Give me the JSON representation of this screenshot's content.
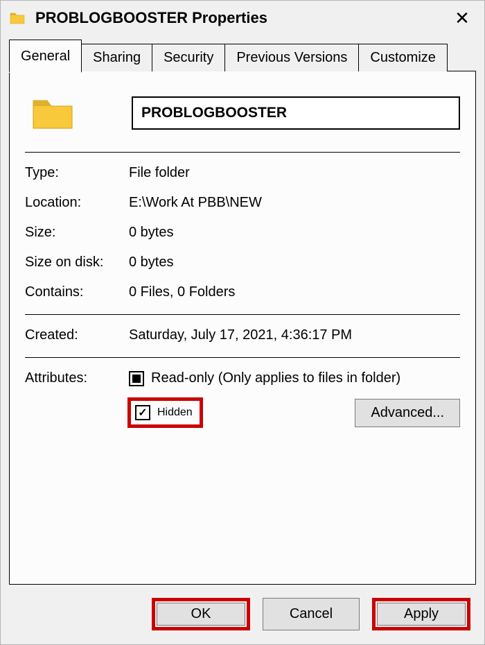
{
  "titlebar": {
    "title": "PROBLOGBOOSTER Properties"
  },
  "tabs": {
    "items": [
      "General",
      "Sharing",
      "Security",
      "Previous Versions",
      "Customize"
    ],
    "active": 0
  },
  "general": {
    "name": "PROBLOGBOOSTER",
    "fields": {
      "type_label": "Type:",
      "type_value": "File folder",
      "location_label": "Location:",
      "location_value": "E:\\Work At PBB\\NEW",
      "size_label": "Size:",
      "size_value": "0 bytes",
      "sizeondisk_label": "Size on disk:",
      "sizeondisk_value": "0 bytes",
      "contains_label": "Contains:",
      "contains_value": "0 Files, 0 Folders",
      "created_label": "Created:",
      "created_value": "Saturday, July 17, 2021, 4:36:17 PM"
    },
    "attributes": {
      "label": "Attributes:",
      "readonly_label": "Read-only (Only applies to files in folder)",
      "readonly_state": "indeterminate",
      "hidden_label": "Hidden",
      "hidden_state": "checked",
      "advanced_label": "Advanced..."
    }
  },
  "buttons": {
    "ok": "OK",
    "cancel": "Cancel",
    "apply": "Apply"
  }
}
